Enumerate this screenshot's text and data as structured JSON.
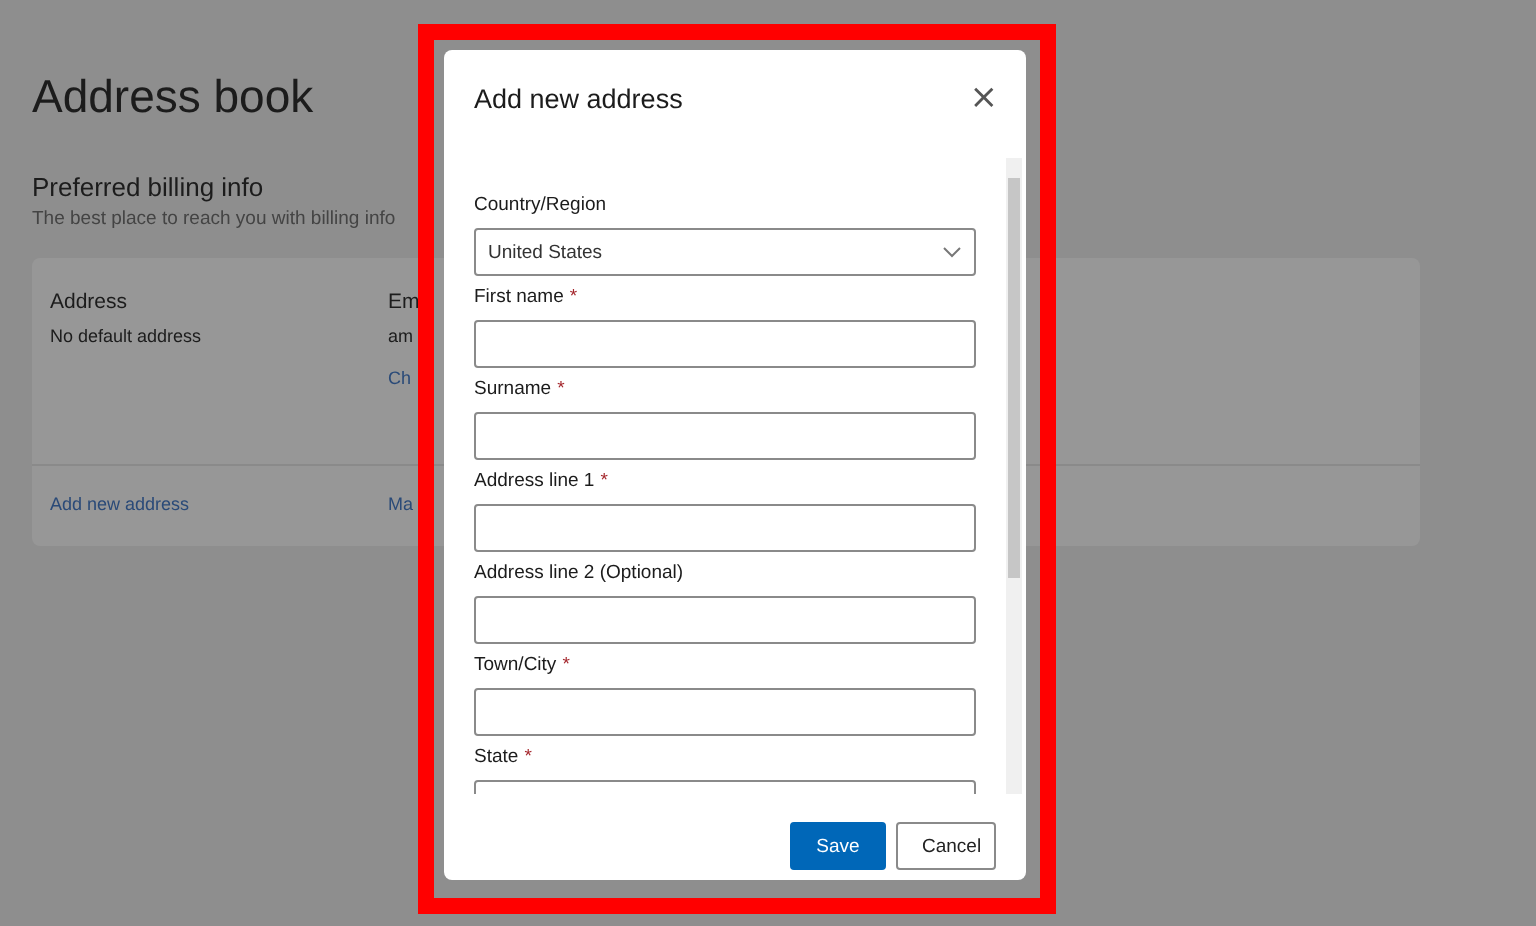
{
  "page": {
    "title": "Address book",
    "section_title": "Preferred billing info",
    "section_subtitle": "The best place to reach you with billing info",
    "card": {
      "columns": [
        {
          "heading": "Address",
          "lines": [
            {
              "text": "No default address",
              "kind": "text"
            }
          ]
        },
        {
          "heading": "Em",
          "lines": [
            {
              "text": "am",
              "kind": "text"
            },
            {
              "text": "Ch",
              "kind": "link"
            }
          ]
        }
      ],
      "footer_links": [
        "Add new address",
        "Ma"
      ]
    }
  },
  "dialog": {
    "title": "Add new address",
    "close": "×",
    "fields": [
      {
        "label": "Country/Region",
        "kind": "select",
        "value": "United States"
      },
      {
        "label": "First name",
        "required_mark": "*",
        "kind": "text"
      },
      {
        "label": "Surname",
        "required_mark": "*",
        "kind": "text"
      },
      {
        "label": "Address line 1",
        "required_mark": "*",
        "kind": "text"
      },
      {
        "label": "Address line 2 (Optional)",
        "kind": "text"
      },
      {
        "label": "Town/City",
        "required_mark": "*",
        "kind": "text"
      },
      {
        "label": "State",
        "required_mark": "*",
        "kind": "select"
      }
    ],
    "buttons": [
      {
        "label": "Save",
        "kind": "primary"
      },
      {
        "label": "Cancel",
        "kind": "secondary"
      }
    ]
  }
}
